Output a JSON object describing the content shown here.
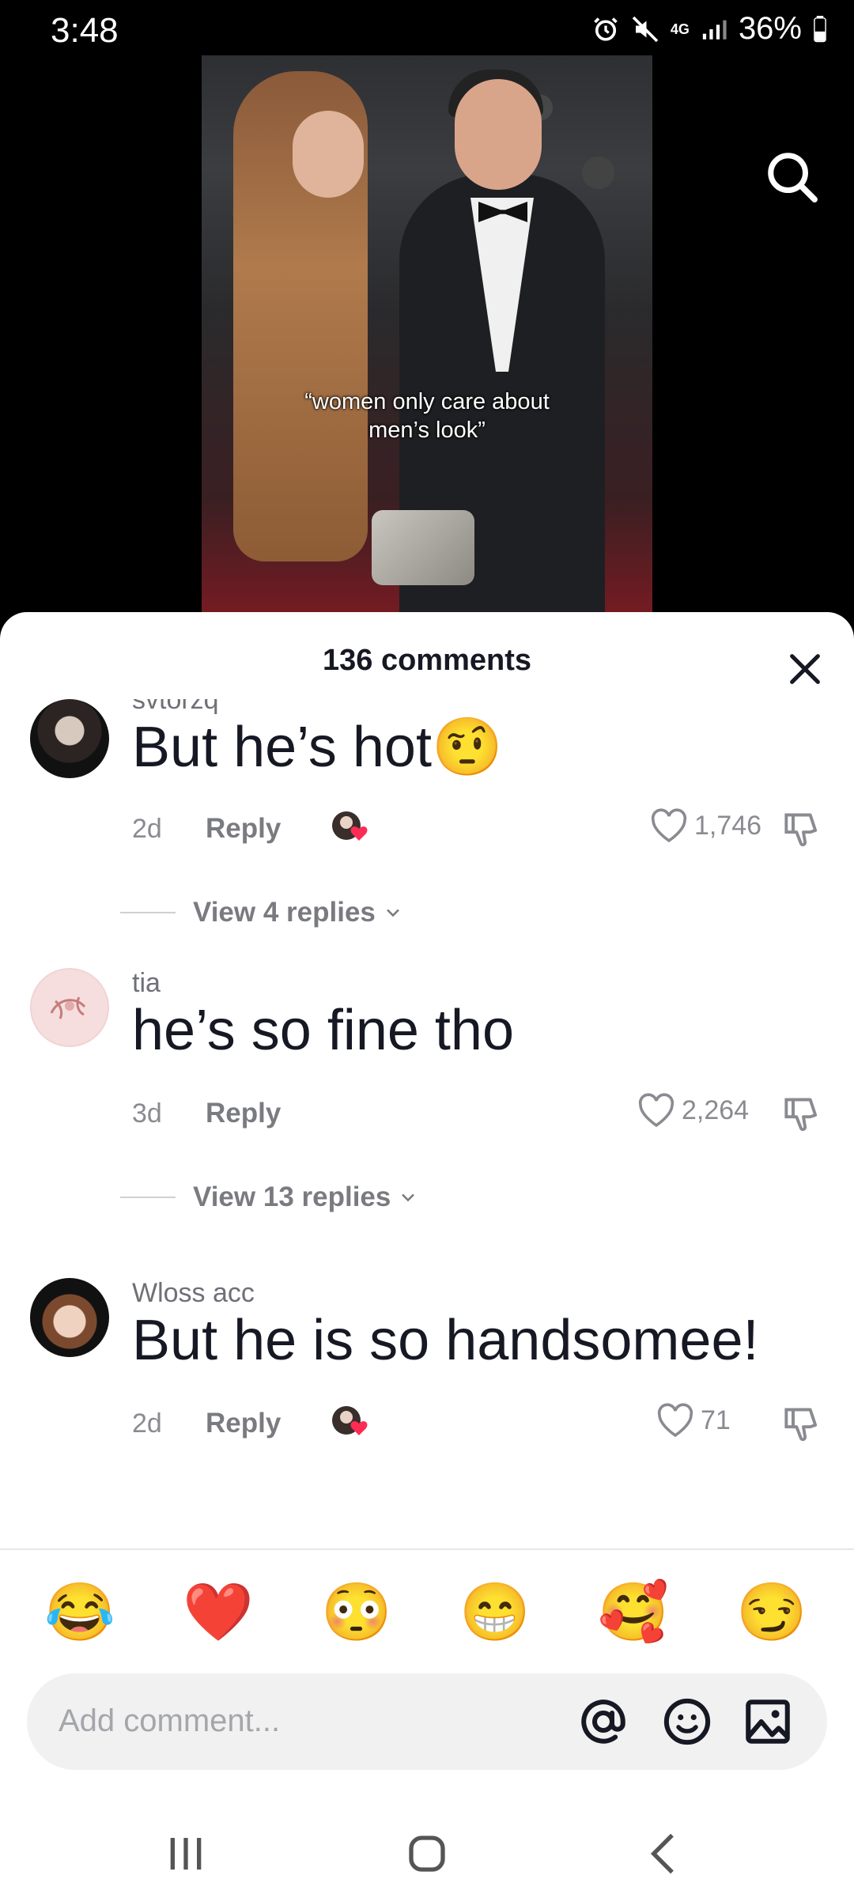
{
  "status": {
    "time": "3:48",
    "network": "4G",
    "battery": "36%",
    "icons": [
      "alarm-icon",
      "mute-icon",
      "network-4g-icon",
      "signal-icon",
      "battery-icon"
    ]
  },
  "video": {
    "caption_line1": "“women only care about",
    "caption_line2": "men’s look”"
  },
  "sheet": {
    "title": "136 comments"
  },
  "comments": [
    {
      "username": "svtorzq",
      "text": "But he’s hot🤨",
      "age": "2d",
      "reply_label": "Reply",
      "likes": "1,746",
      "creator_liked": true,
      "view_replies": "View 4 replies"
    },
    {
      "username": "tia",
      "text": "he’s so fine tho",
      "age": "3d",
      "reply_label": "Reply",
      "likes": "2,264",
      "creator_liked": false,
      "view_replies": "View 13 replies"
    },
    {
      "username": "Wloss acc",
      "text": "But he is so handsomee!",
      "age": "2d",
      "reply_label": "Reply",
      "likes": "71",
      "creator_liked": true
    }
  ],
  "quick_emojis": [
    "😂",
    "❤️",
    "😳",
    "😁",
    "🥰",
    "😏"
  ],
  "composer": {
    "placeholder": "Add comment...",
    "icons": [
      "mention-icon",
      "emoji-icon",
      "image-icon"
    ]
  },
  "colors": {
    "text_primary": "#161823",
    "text_secondary": "#8a8b91",
    "like_heart": "#fe2c55"
  }
}
